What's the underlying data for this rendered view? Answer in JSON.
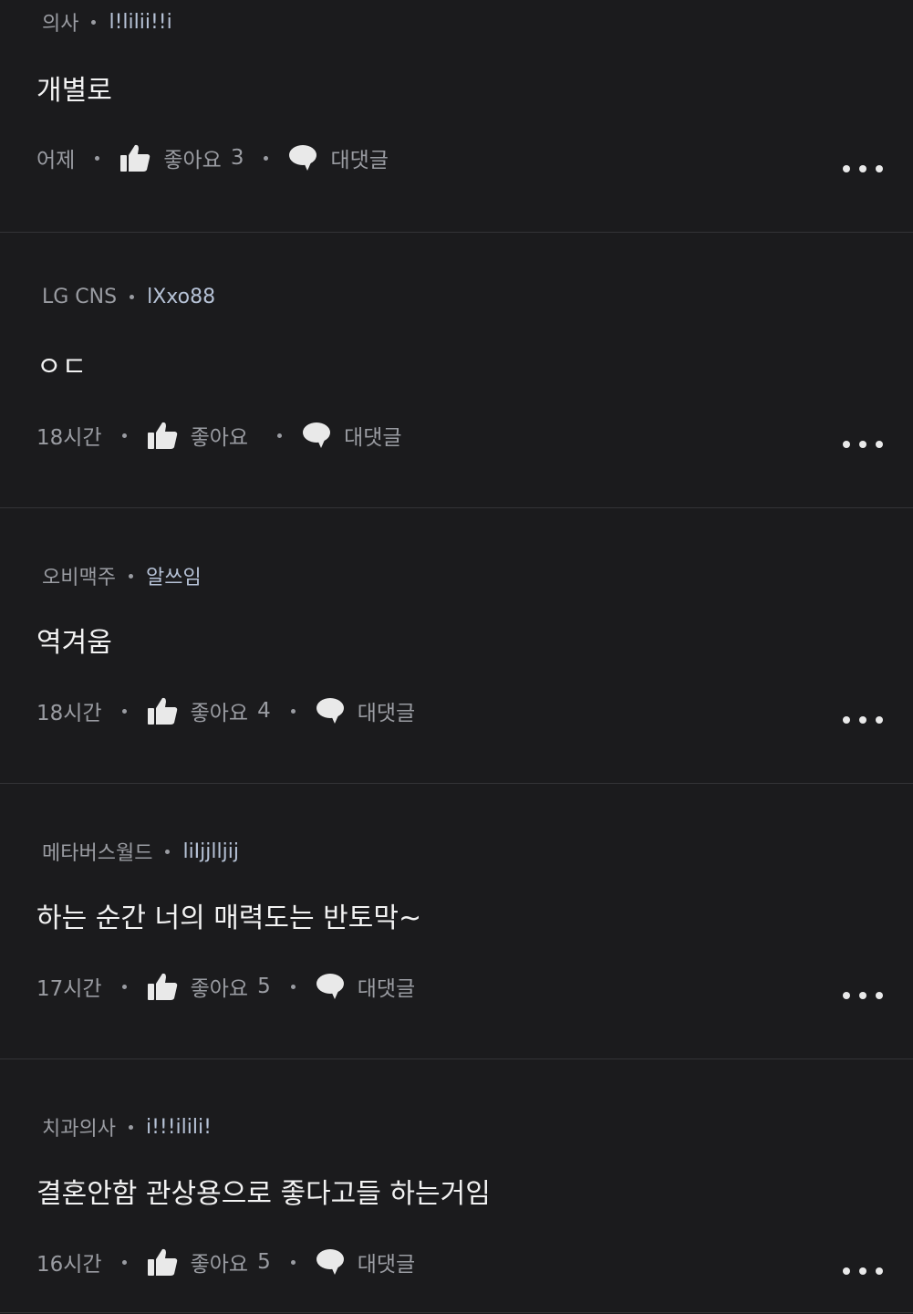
{
  "comments": [
    {
      "company": "의사",
      "nickname": "l!lilii!!i",
      "text": "개별로",
      "time": "어제",
      "like_label": "좋아요",
      "like_count": "3",
      "reply_label": "대댓글"
    },
    {
      "company": "LG CNS",
      "nickname": "lXxo88",
      "text": "ㅇㄷ",
      "time": "18시간",
      "like_label": "좋아요",
      "like_count": "",
      "reply_label": "대댓글"
    },
    {
      "company": "오비맥주",
      "nickname": "알쓰임",
      "text": "역겨움",
      "time": "18시간",
      "like_label": "좋아요",
      "like_count": "4",
      "reply_label": "대댓글"
    },
    {
      "company": "메타버스월드",
      "nickname": "liIjjlljij",
      "text": "하는 순간 너의 매력도는 반토막~",
      "time": "17시간",
      "like_label": "좋아요",
      "like_count": "5",
      "reply_label": "대댓글"
    },
    {
      "company": "치과의사",
      "nickname": "i!!!ilili!",
      "text": "결혼안함 관상용으로 좋다고들 하는거임",
      "time": "16시간",
      "like_label": "좋아요",
      "like_count": "5",
      "reply_label": "대댓글"
    }
  ],
  "icons": {
    "like": "thumbs-up-icon",
    "reply": "speech-bubble-icon",
    "more": "more-horizontal-icon"
  },
  "colors": {
    "background": "#1b1b1d",
    "divider": "#333336",
    "muted_text": "#9a9ca2",
    "nickname": "#b6c2d6",
    "body_text": "#f2f2f2"
  }
}
